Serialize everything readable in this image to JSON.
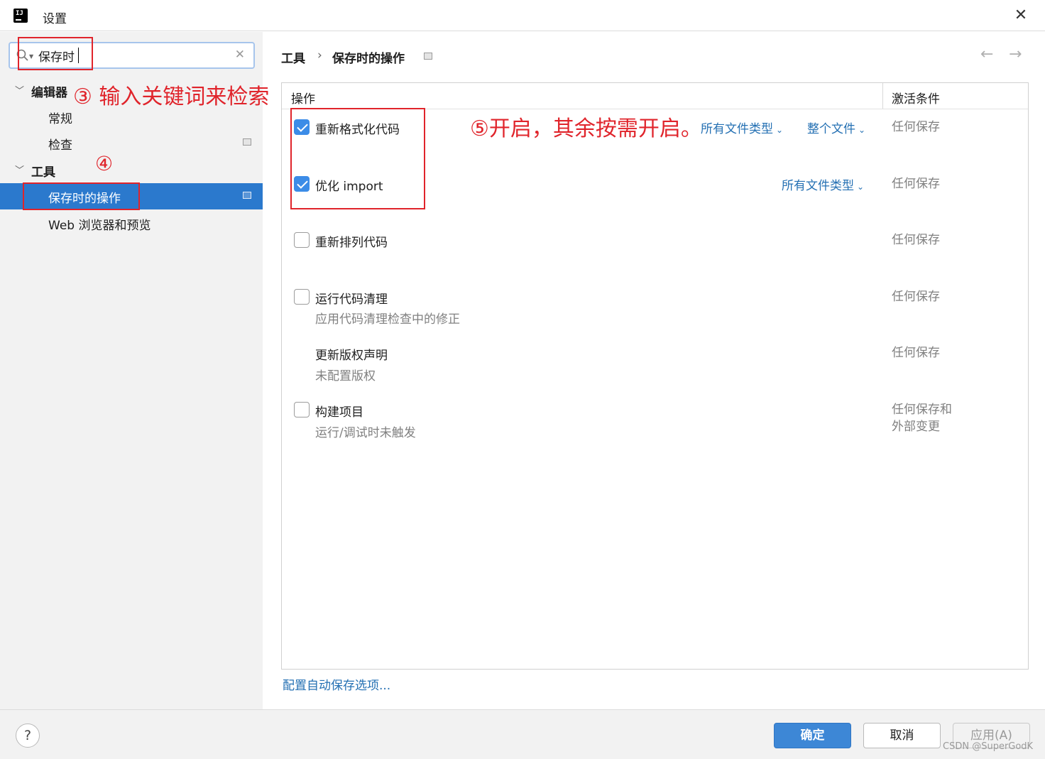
{
  "window": {
    "title": "设置",
    "close_glyph": "✕",
    "logo_text": "IJ"
  },
  "search": {
    "value": "保存时",
    "clear_glyph": "✕"
  },
  "sidebar": {
    "groups": [
      {
        "label": "编辑器",
        "children": [
          {
            "label": "常规"
          },
          {
            "label": "检查"
          }
        ]
      },
      {
        "label": "工具",
        "children": [
          {
            "label": "保存时的操作",
            "selected": true
          },
          {
            "label": "Web 浏览器和预览"
          }
        ]
      }
    ]
  },
  "breadcrumb": {
    "parent": "工具",
    "separator": "›",
    "current": "保存时的操作"
  },
  "nav": {
    "back_glyph": "←",
    "forward_glyph": "→"
  },
  "table": {
    "col_action": "操作",
    "col_condition": "激活条件",
    "rows": [
      {
        "label": "重新格式化代码",
        "checked": true,
        "links": [
          "所有文件类型",
          "整个文件"
        ],
        "condition": "任何保存"
      },
      {
        "label": "优化 import",
        "checked": true,
        "links": [
          "所有文件类型"
        ],
        "condition": "任何保存"
      },
      {
        "label": "重新排列代码",
        "checked": false,
        "condition": "任何保存"
      },
      {
        "label": "运行代码清理",
        "checked": false,
        "sub": "应用代码清理检查中的修正",
        "condition": "任何保存"
      },
      {
        "label": "更新版权声明",
        "sub": "未配置版权",
        "condition": "任何保存"
      },
      {
        "label": "构建项目",
        "checked": false,
        "sub": "运行/调试时未触发",
        "condition_line1": "任何保存和",
        "condition_line2": "外部变更"
      }
    ],
    "dropdown_glyph": "⌄"
  },
  "config_link": "配置自动保存选项...",
  "footer": {
    "help": "?",
    "ok": "确定",
    "cancel": "取消",
    "apply": "应用(A)"
  },
  "watermark": "CSDN @SuperGodK",
  "annotations": {
    "step3": "③ 输入关键词来检索",
    "step4": "④",
    "step5": "⑤开启，其余按需开启。",
    "color": "#e0242b"
  },
  "colors": {
    "selection": "#2b79cd",
    "link": "#2470b3",
    "checkbox": "#3c8ce7",
    "ok_button": "#3d87d6"
  }
}
